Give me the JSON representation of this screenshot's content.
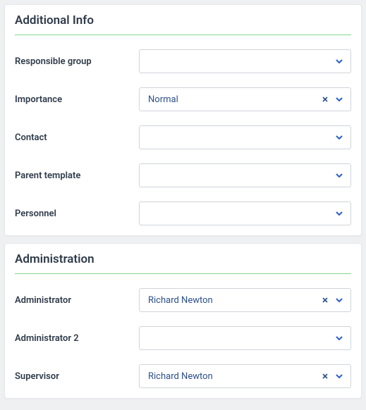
{
  "sections": {
    "additional_info": {
      "title": "Additional Info",
      "fields": {
        "responsible_group": {
          "label": "Responsible group",
          "value": ""
        },
        "importance": {
          "label": "Importance",
          "value": "Normal"
        },
        "contact": {
          "label": "Contact",
          "value": ""
        },
        "parent_template": {
          "label": "Parent template",
          "value": ""
        },
        "personnel": {
          "label": "Personnel",
          "value": ""
        }
      }
    },
    "administration": {
      "title": "Administration",
      "fields": {
        "administrator": {
          "label": "Administrator",
          "value": "Richard Newton"
        },
        "administrator_2": {
          "label": "Administrator 2",
          "value": ""
        },
        "supervisor": {
          "label": "Supervisor",
          "value": "Richard Newton"
        }
      }
    }
  }
}
